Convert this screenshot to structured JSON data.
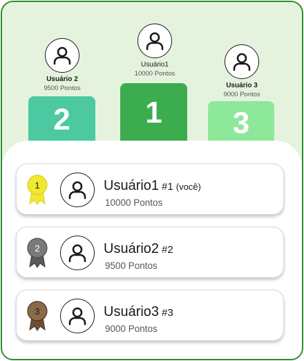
{
  "podium": [
    {
      "name": "Usuário 2",
      "points": "9500 Pontos",
      "place": "2",
      "color": "#4cc9a0"
    },
    {
      "name": "Usuário1",
      "points": "10000 Pontos",
      "place": "1",
      "color": "#3cad4e"
    },
    {
      "name": "Usuário 3",
      "points": "9000 Pontos",
      "place": "3",
      "color": "#8ee89a"
    }
  ],
  "ranking": [
    {
      "name": "Usuário1",
      "rank": "#1",
      "you": "(você)",
      "points": "10000 Pontos",
      "medal_number": "1",
      "medal_color": "#f2e832"
    },
    {
      "name": "Usuário2",
      "rank": "#2",
      "points": "9500 Pontos",
      "medal_number": "2",
      "medal_color": "#7a7a7a"
    },
    {
      "name": "Usuário3",
      "rank": "#3",
      "points": "9000 Pontos",
      "medal_number": "3",
      "medal_color": "#8b6a4c"
    }
  ],
  "icons": {
    "avatar": "user-icon",
    "medal": "medal-icon"
  },
  "colors": {
    "frame_border": "#2e8b2e",
    "background": "#e5f3de"
  }
}
